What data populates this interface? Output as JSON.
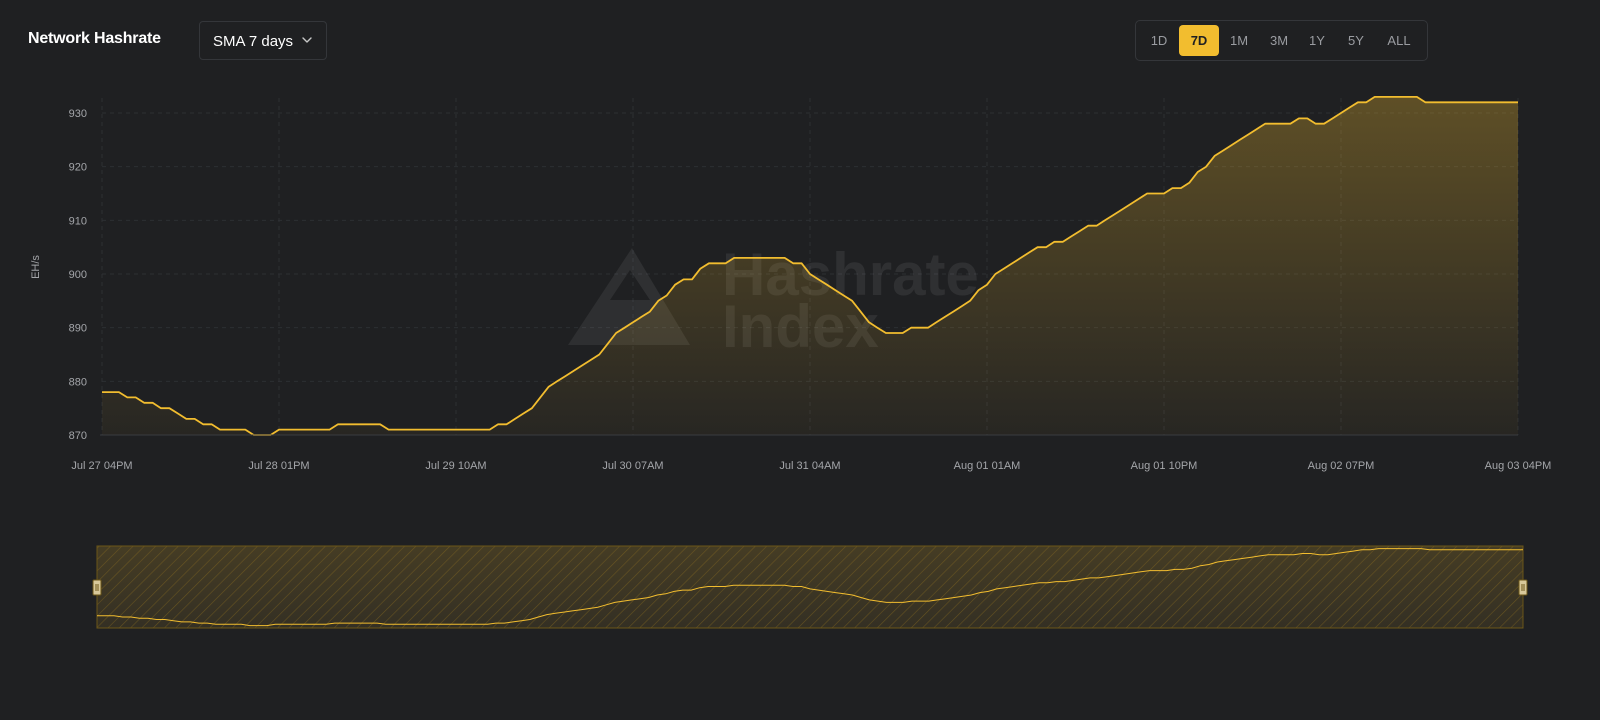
{
  "header": {
    "title": "Network Hashrate",
    "sma_select": {
      "selected": "SMA 7 days"
    }
  },
  "ranges": [
    {
      "label": "1D",
      "active": false
    },
    {
      "label": "7D",
      "active": true
    },
    {
      "label": "1M",
      "active": false
    },
    {
      "label": "3M",
      "active": false
    },
    {
      "label": "1Y",
      "active": false
    },
    {
      "label": "5Y",
      "active": false
    },
    {
      "label": "ALL",
      "active": false
    }
  ],
  "colors": {
    "background": "#1f2022",
    "accent": "#f2bd2f",
    "grid": "#2d2f33",
    "tick_text": "#a4a6aa"
  },
  "watermark": {
    "line1": "Hashrate",
    "line2": "Index"
  },
  "chart_data": {
    "type": "area",
    "title": "Network Hashrate",
    "ylabel": "EH/s",
    "xlabel": "",
    "ylim": [
      868,
      933
    ],
    "yticks": [
      870,
      880,
      890,
      900,
      910,
      920,
      930
    ],
    "xlim": [
      0,
      168
    ],
    "xticks": [
      {
        "t": 0,
        "label": "Jul 27 04PM"
      },
      {
        "t": 21,
        "label": "Jul 28 01PM"
      },
      {
        "t": 42,
        "label": "Jul 29 10AM"
      },
      {
        "t": 63,
        "label": "Jul 30 07AM"
      },
      {
        "t": 84,
        "label": "Jul 31 04AM"
      },
      {
        "t": 105,
        "label": "Aug 01 01AM"
      },
      {
        "t": 126,
        "label": "Aug 01 10PM"
      },
      {
        "t": 147,
        "label": "Aug 02 07PM"
      },
      {
        "t": 168,
        "label": "Aug 03 04PM"
      }
    ],
    "grid": true,
    "legend": "none",
    "series": [
      {
        "x": [
          0,
          2,
          3,
          4,
          5,
          6,
          7,
          8,
          9,
          10,
          11,
          12,
          13,
          14,
          15,
          16,
          17,
          18,
          19,
          20,
          21,
          24,
          27,
          28,
          33,
          34,
          36,
          37,
          46,
          47,
          48,
          49,
          50,
          51,
          52,
          53,
          54,
          55,
          56,
          57,
          58,
          59,
          60,
          61,
          62,
          63,
          64,
          65,
          66,
          67,
          68,
          69,
          70,
          71,
          72,
          73,
          74,
          75,
          76,
          77,
          78,
          79,
          80,
          81,
          82,
          83,
          84,
          85,
          86,
          87,
          88,
          89,
          90,
          91,
          92,
          93,
          94,
          95,
          96,
          97,
          98,
          99,
          100,
          101,
          102,
          103,
          104,
          105,
          106,
          107,
          108,
          109,
          110,
          111,
          112,
          113,
          114,
          115,
          116,
          117,
          118,
          119,
          120,
          121,
          122,
          123,
          124,
          125,
          126,
          127,
          128,
          129,
          130,
          131,
          132,
          133,
          134,
          135,
          136,
          137,
          138,
          139,
          140,
          141,
          142,
          143,
          144,
          145,
          146,
          147,
          148,
          149,
          150,
          151,
          152,
          153,
          154,
          155,
          156,
          157,
          158,
          159,
          160,
          161,
          162,
          163,
          164,
          165,
          166,
          167,
          168
        ],
        "values": [
          878,
          878,
          877,
          877,
          876,
          876,
          875,
          875,
          874,
          873,
          873,
          872,
          872,
          871,
          871,
          871,
          871,
          870,
          870,
          870,
          871,
          871,
          871,
          872,
          872,
          871,
          871,
          871,
          871,
          872,
          872,
          873,
          874,
          875,
          877,
          879,
          880,
          881,
          882,
          883,
          884,
          885,
          887,
          889,
          890,
          891,
          892,
          893,
          895,
          896,
          898,
          899,
          899,
          901,
          902,
          902,
          902,
          903,
          903,
          903,
          903,
          903,
          903,
          903,
          902,
          902,
          900,
          899,
          898,
          897,
          896,
          895,
          893,
          891,
          890,
          889,
          889,
          889,
          890,
          890,
          890,
          891,
          892,
          893,
          894,
          895,
          897,
          898,
          900,
          901,
          902,
          903,
          904,
          905,
          905,
          906,
          906,
          907,
          908,
          909,
          909,
          910,
          911,
          912,
          913,
          914,
          915,
          915,
          915,
          916,
          916,
          917,
          919,
          920,
          922,
          923,
          924,
          925,
          926,
          927,
          928,
          928,
          928,
          928,
          929,
          929,
          928,
          928,
          929,
          930,
          931,
          932,
          932,
          933,
          933,
          933,
          933,
          933,
          933,
          932,
          932,
          932,
          932,
          932,
          932,
          932,
          932,
          932,
          932,
          932,
          932
        ]
      }
    ]
  }
}
